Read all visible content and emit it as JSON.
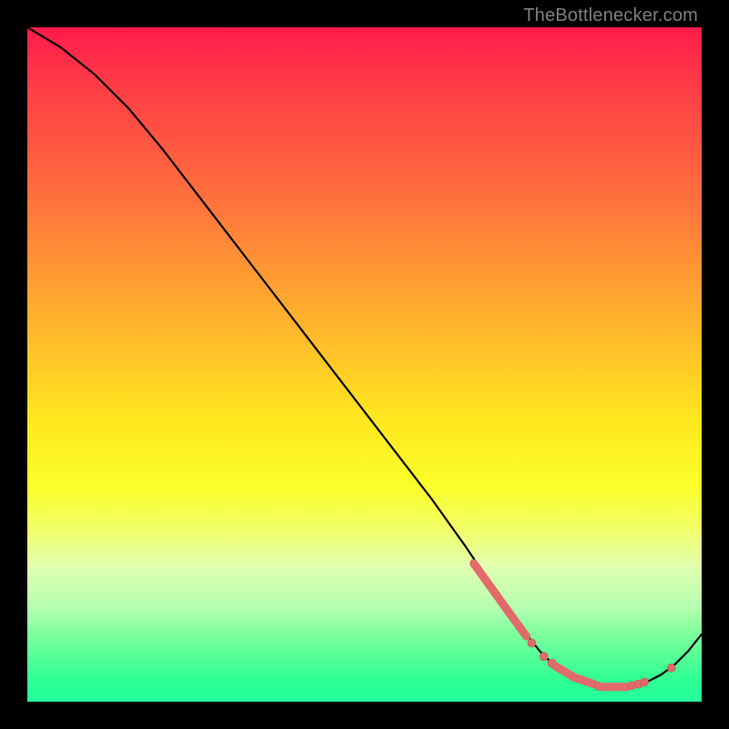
{
  "attribution": "TheBottlenecker.com",
  "colors": {
    "page_bg": "#000000",
    "attribution_text": "#7f7f7f",
    "curve_stroke": "#000000",
    "marker_fill": "#e26a6a",
    "marker_stroke": "#c74e4e",
    "gradient_stops": [
      "#ff1b4a",
      "#ff3a47",
      "#ff6f3d",
      "#ffad2e",
      "#ffe61f",
      "#fbff2a",
      "#f2ff63",
      "#e0ffb0",
      "#b6ffb0",
      "#7dff9c",
      "#4dff95",
      "#2dff95",
      "#23ff9b"
    ]
  },
  "chart_data": {
    "type": "line",
    "title": "",
    "xlabel": "",
    "ylabel": "",
    "xlim": [
      0,
      100
    ],
    "ylim": [
      0,
      100
    ],
    "grid": false,
    "legend": false,
    "series": [
      {
        "name": "bottleneck-curve",
        "x": [
          0,
          5,
          10,
          15,
          20,
          25,
          30,
          35,
          40,
          45,
          50,
          55,
          60,
          65,
          68,
          70,
          72,
          74,
          76,
          78,
          80,
          82,
          84,
          86,
          88,
          90,
          92,
          94,
          96,
          98,
          100
        ],
        "y": [
          100,
          97,
          93,
          88,
          82,
          75.5,
          69,
          62.5,
          56,
          49.5,
          43,
          36.5,
          30,
          23,
          18.5,
          15.5,
          12.5,
          10,
          7.5,
          5.5,
          4,
          3,
          2.4,
          2,
          2,
          2.3,
          3,
          4,
          5.5,
          7.5,
          10
        ]
      }
    ],
    "markers": [
      {
        "kind": "dash",
        "x1": 66.2,
        "y1": 20.5,
        "x2": 69.8,
        "y2": 15.5
      },
      {
        "kind": "dash",
        "x1": 70.0,
        "y1": 15.2,
        "x2": 74.0,
        "y2": 9.7
      },
      {
        "kind": "dot",
        "x": 74.8,
        "y": 8.7
      },
      {
        "kind": "dot",
        "x": 76.6,
        "y": 6.7
      },
      {
        "kind": "dot",
        "x": 77.8,
        "y": 5.7
      },
      {
        "kind": "dash",
        "x1": 78.4,
        "y1": 5.2,
        "x2": 80.8,
        "y2": 3.8
      },
      {
        "kind": "dash",
        "x1": 80.8,
        "y1": 3.7,
        "x2": 84.0,
        "y2": 2.6
      },
      {
        "kind": "dot",
        "x": 84.7,
        "y": 2.3
      },
      {
        "kind": "dash",
        "x1": 85.2,
        "y1": 2.2,
        "x2": 89.0,
        "y2": 2.2
      },
      {
        "kind": "dot",
        "x": 89.7,
        "y": 2.4
      },
      {
        "kind": "dot",
        "x": 90.6,
        "y": 2.6
      },
      {
        "kind": "dot",
        "x": 91.5,
        "y": 2.9
      },
      {
        "kind": "dot",
        "x": 95.5,
        "y": 5.0
      }
    ]
  }
}
